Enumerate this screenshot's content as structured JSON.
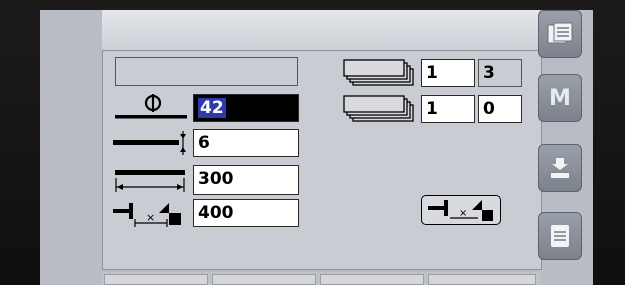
{
  "screen": {
    "title_value": "",
    "inputs": [
      {
        "id": "diameter",
        "icon": "diameter-icon",
        "value": "42",
        "selected": true
      },
      {
        "id": "thickness",
        "icon": "thickness-icon",
        "value": "6",
        "selected": false
      },
      {
        "id": "length",
        "icon": "length-icon",
        "value": "300",
        "selected": false
      },
      {
        "id": "backgauge",
        "icon": "backgauge-distance-icon",
        "value": "400",
        "selected": false
      }
    ],
    "stack_counters": [
      {
        "id": "stack-a",
        "icon": "stacked-sheets-icon",
        "current": "1",
        "total": "3"
      },
      {
        "id": "stack-b",
        "icon": "stacked-sheets-icon",
        "current": "1",
        "total": "0"
      }
    ],
    "right_button_icon": "backgauge-retract-icon"
  },
  "left_nav": [
    {
      "id": "program",
      "icon": "document-icon",
      "active": true
    },
    {
      "id": "manual",
      "icon": "hand-icon",
      "active": false
    },
    {
      "id": "tools",
      "icon": "wrench-icon",
      "active": false
    },
    {
      "id": "factory",
      "icon": "factory-icon",
      "active": false
    }
  ],
  "right_nav": [
    {
      "id": "programs-list",
      "icon": "document-list-icon"
    },
    {
      "id": "memory",
      "label": "M",
      "icon": "memory-icon"
    },
    {
      "id": "transfer",
      "icon": "transfer-icon"
    },
    {
      "id": "notes",
      "icon": "note-icon"
    }
  ]
}
